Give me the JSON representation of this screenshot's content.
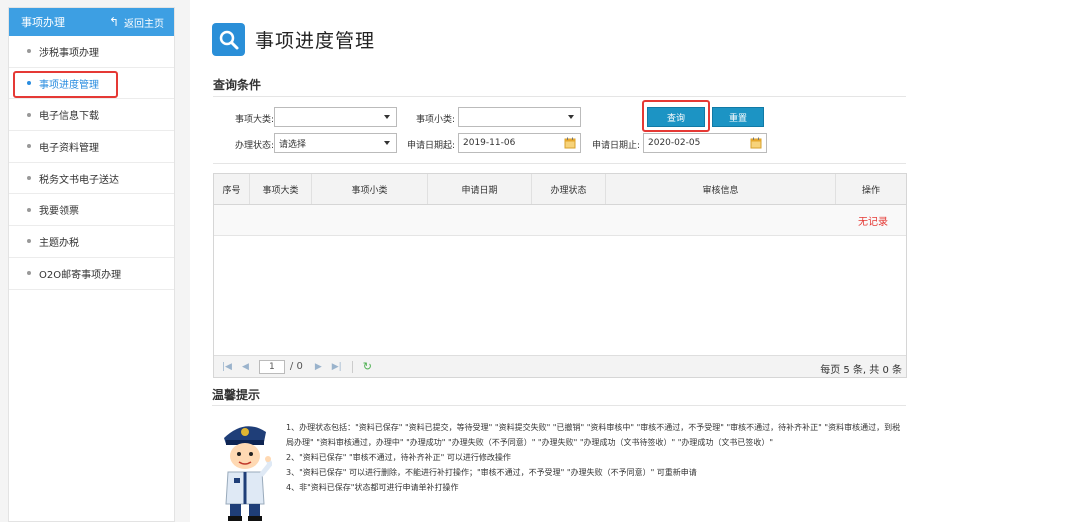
{
  "sidebar": {
    "title": "事项办理",
    "back_label": "返回主页",
    "items": [
      {
        "label": "涉税事项办理"
      },
      {
        "label": "事项进度管理"
      },
      {
        "label": "电子信息下载"
      },
      {
        "label": "电子资料管理"
      },
      {
        "label": "税务文书电子送达"
      },
      {
        "label": "我要领票"
      },
      {
        "label": "主题办税"
      },
      {
        "label": "O2O邮寄事项办理"
      }
    ],
    "active_index": 1
  },
  "page": {
    "title": "事项进度管理",
    "section_query": "查询条件"
  },
  "form": {
    "major_label": "事项大类:",
    "major_value": "",
    "minor_label": "事项小类:",
    "minor_value": "",
    "status_label": "办理状态:",
    "status_value": "请选择",
    "start_label": "申请日期起:",
    "start_value": "2019-11-06",
    "end_label": "申请日期止:",
    "end_value": "2020-02-05",
    "query_button": "查询",
    "reset_button": "重置"
  },
  "table": {
    "columns": [
      "序号",
      "事项大类",
      "事项小类",
      "申请日期",
      "办理状态",
      "审核信息",
      "操作"
    ],
    "empty_text": "无记录"
  },
  "pager": {
    "current_page": "1",
    "total_pages": "/ 0",
    "info": "每页 5 条, 共 0 条"
  },
  "tips": {
    "title": "温馨提示",
    "lines": [
      "1、办理状态包括：\"资料已保存\" \"资料已提交，等待受理\" \"资料提交失败\" \"已撤销\" \"资料审核中\" \"审核不通过，不予受理\" \"审核不通过，待补齐补正\" \"资料审核通过，到税局办理\" \"资料审核通过，办理中\" \"办理成功\" \"办理失败（不予同意）\" \"办理失败\" \"办理成功（文书待签收）\" \"办理成功（文书已签收）\"",
      "2、\"资料已保存\" \"审核不通过，待补齐补正\" 可以进行修改操作",
      "3、\"资料已保存\" 可以进行删除，不能进行补打操作；\"审核不通过，不予受理\" \"办理失败（不予同意）\" 可重新申请",
      "4、非\"资料已保存\"状态都可进行申请单补打操作"
    ]
  },
  "colors": {
    "primary": "#3d9fe3",
    "button": "#1c94c4",
    "highlight": "#e53935",
    "empty_text": "#e53935"
  }
}
